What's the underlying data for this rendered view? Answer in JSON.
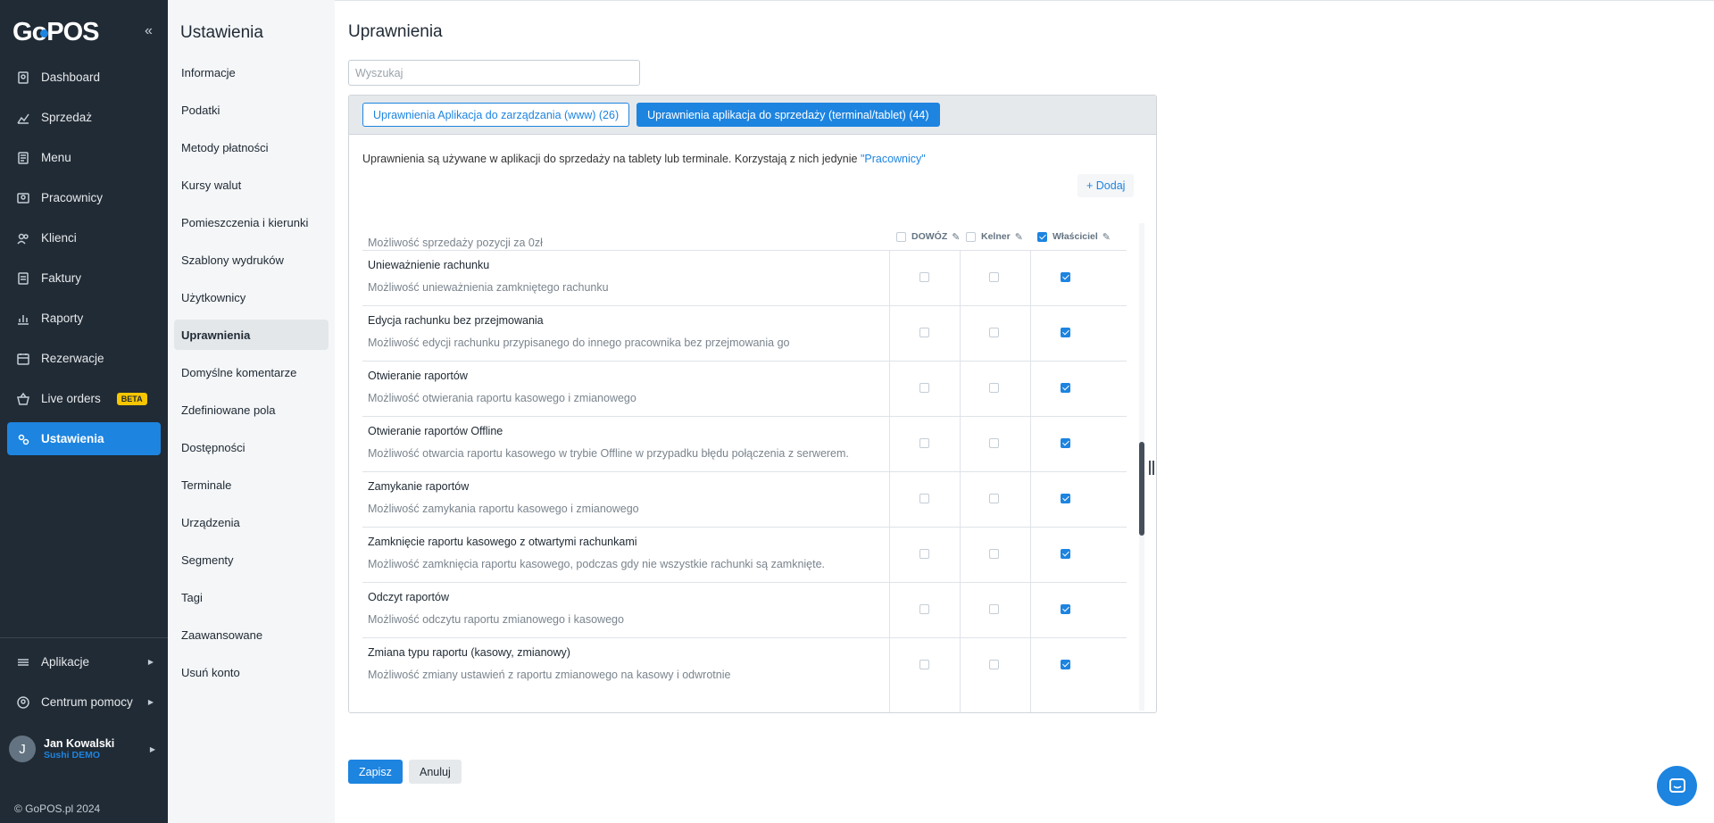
{
  "app": {
    "logo_text_a": "G",
    "logo_text_b": "POS",
    "collapse_icon": "«"
  },
  "sidebar": {
    "items": [
      {
        "label": "Dashboard",
        "icon": "dashboard-icon"
      },
      {
        "label": "Sprzedaż",
        "icon": "sales-icon"
      },
      {
        "label": "Menu",
        "icon": "menu-icon"
      },
      {
        "label": "Pracownicy",
        "icon": "employees-icon"
      },
      {
        "label": "Klienci",
        "icon": "clients-icon"
      },
      {
        "label": "Faktury",
        "icon": "invoices-icon"
      },
      {
        "label": "Raporty",
        "icon": "reports-icon"
      },
      {
        "label": "Rezerwacje",
        "icon": "calendar-icon"
      },
      {
        "label": "Live orders",
        "icon": "basket-icon",
        "badge": "BETA"
      },
      {
        "label": "Ustawienia",
        "icon": "settings-icon",
        "active": true
      }
    ],
    "bottom": [
      {
        "label": "Aplikacje",
        "icon": "apps-icon"
      },
      {
        "label": "Centrum pomocy",
        "icon": "help-icon"
      }
    ],
    "user": {
      "initial": "J",
      "name": "Jan Kowalski",
      "org": "Sushi DEMO"
    },
    "copyright": "© GoPOS.pl 2024"
  },
  "subnav": {
    "title": "Ustawienia",
    "items": [
      "Informacje",
      "Podatki",
      "Metody płatności",
      "Kursy walut",
      "Pomieszczenia i kierunki",
      "Szablony wydruków",
      "Użytkownicy",
      "Uprawnienia",
      "Domyślne komentarze",
      "Zdefiniowane pola",
      "Dostępności",
      "Terminale",
      "Urządzenia",
      "Segmenty",
      "Tagi",
      "Zaawansowane",
      "Usuń konto"
    ],
    "active_index": 7
  },
  "main": {
    "title": "Uprawnienia",
    "search_placeholder": "Wyszukaj",
    "tabs": [
      {
        "label": "Uprawnienia Aplikacja do zarządzania (www) (26)",
        "active": false
      },
      {
        "label": "Uprawnienia aplikacja do sprzedaży (terminal/tablet) (44)",
        "active": true
      }
    ],
    "description": "Uprawnienia są używane w aplikacji do sprzedaży na tablety lub terminale. Korzystają z nich jedynie",
    "description_link": "\"Pracownicy\"",
    "add_label": "+ Dodaj",
    "columns": [
      {
        "label": "DOWÓZ",
        "checked": false
      },
      {
        "label": "Kelner",
        "checked": false
      },
      {
        "label": "Właściciel",
        "checked": true
      }
    ],
    "partial_row_text": "Możliwość sprzedaży pozycji za 0zł",
    "rows": [
      {
        "title": "Unieważnienie rachunku",
        "desc": "Możliwość unieważnienia zamkniętego rachunku",
        "values": [
          false,
          false,
          true
        ]
      },
      {
        "title": "Edycja rachunku bez przejmowania",
        "desc": "Możliwość edycji rachunku przypisanego do innego pracownika bez przejmowania go",
        "values": [
          false,
          false,
          true
        ]
      },
      {
        "title": "Otwieranie raportów",
        "desc": "Możliwość otwierania raportu kasowego i zmianowego",
        "values": [
          false,
          false,
          true
        ]
      },
      {
        "title": "Otwieranie raportów Offline",
        "desc": "Możliwość otwarcia raportu kasowego w trybie Offline w przypadku błędu połączenia z serwerem.",
        "values": [
          false,
          false,
          true
        ]
      },
      {
        "title": "Zamykanie raportów",
        "desc": "Możliwość zamykania raportu kasowego i zmianowego",
        "values": [
          false,
          false,
          true
        ]
      },
      {
        "title": "Zamknięcie raportu kasowego z otwartymi rachunkami",
        "desc": "Możliwość zamknięcia raportu kasowego, podczas gdy nie wszystkie rachunki są zamknięte.",
        "values": [
          false,
          false,
          true
        ]
      },
      {
        "title": "Odczyt raportów",
        "desc": "Możliwość odczytu raportu zmianowego i kasowego",
        "values": [
          false,
          false,
          true
        ]
      },
      {
        "title": "Zmiana typu raportu (kasowy, zmianowy)",
        "desc": "Możliwość zmiany ustawień z raportu zmianowego na kasowy i odwrotnie",
        "values": [
          false,
          false,
          true
        ]
      }
    ],
    "save_label": "Zapisz",
    "cancel_label": "Anuluj"
  },
  "colors": {
    "accent": "#1d84e0",
    "sidebar_bg": "#212b35",
    "beta_badge": "#f7c600"
  }
}
